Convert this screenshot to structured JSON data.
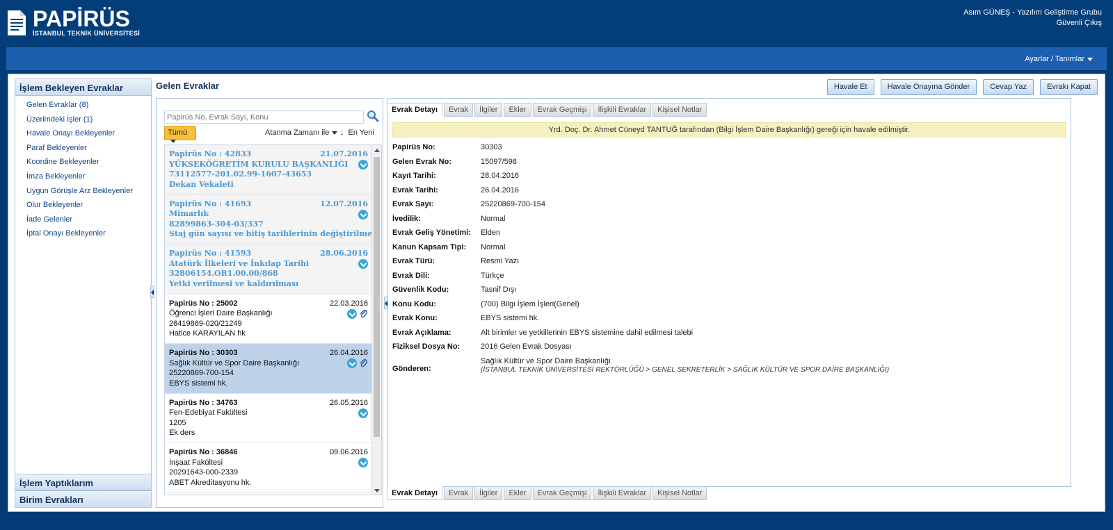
{
  "app": {
    "title": "PAPİRÜS",
    "subtitle": "İSTANBUL TEKNİK ÜNİVERSİTESİ"
  },
  "user": {
    "name": "Asım GÜNEŞ - Yazılım Geliştirme Grubu",
    "logout": "Güvenli Çıkış"
  },
  "topbar": {
    "settings": "Ayarlar / Tanımlar"
  },
  "leftnav": {
    "header": "İşlem Bekleyen Evraklar",
    "items": [
      "Gelen Evraklar (8)",
      "Üzerimdeki İşler (1)",
      "Havale Onayı Bekleyenler",
      "Paraf Bekleyenler",
      "Koordine Bekleyenler",
      "İmza Bekleyenler",
      "Uygun Görüşle Arz Bekleyenler",
      "Olur Bekleyenler",
      "İade Gelenler",
      "İptal Onayı Bekleyenler"
    ],
    "bottom": [
      "İşlem Yaptıklarım",
      "Birim Evrakları"
    ]
  },
  "page": {
    "title": "Gelen Evraklar"
  },
  "toolbar": {
    "buttons": [
      "Havale Et",
      "Havale Onayına Gönder",
      "Cevap Yaz",
      "Evrakı Kapat"
    ]
  },
  "list": {
    "search_placeholder": "Papirüs No, Evrak Sayı, Konu",
    "filter": "Tümü",
    "sort": "Atanma Zamanı ile",
    "sort_dir": "En Yeni",
    "items": [
      {
        "no": "Papirüs No : 42833",
        "date": "21.07.2016",
        "l1": "YÜKSEKÖĞRETİM KURULU BAŞKANLIĞI",
        "l2": "73112577-201.02.99-1607-43653",
        "l3": "Dekan Vekaleti"
      },
      {
        "no": "Papirüs No : 41693",
        "date": "12.07.2016",
        "l1": "Mimarlık",
        "l2": "82899863-304-03/337",
        "l3": "Staj gün sayısı ve bitiş tarihlerinin değiştirilmesi"
      },
      {
        "no": "Papirüs No : 41593",
        "date": "28.06.2016",
        "l1": "Atatürk İlkeleri ve İnkılap Tarihi",
        "l2": "32806154.OR1.00.00/868",
        "l3": "Yetki verilmesi ve kaldırılması"
      },
      {
        "no": "Papirüs No : 25002",
        "date": "22.03.2016",
        "l1": "Öğrenci İşleri Daire Başkanlığı",
        "l2": "26419869-020/21249",
        "l3": "Hatice KARAYILAN hk"
      },
      {
        "no": "Papirüs No : 30303",
        "date": "26.04.2016",
        "l1": "Sağlık Kültür ve Spor Daire Başkanlığı",
        "l2": "25220869-700-154",
        "l3": "EBYS sistemi hk."
      },
      {
        "no": "Papirüs No : 34763",
        "date": "26.05.2016",
        "l1": "Fen-Edebiyat Fakültesi",
        "l2": "1205",
        "l3": "Ek ders"
      },
      {
        "no": "Papirüs No : 36846",
        "date": "09.06.2016",
        "l1": "İnşaat Fakültesi",
        "l2": "20291643-000-2339",
        "l3": "ABET Akreditasyonu hk."
      }
    ]
  },
  "tabs": [
    "Evrak Detayı",
    "Evrak",
    "İlgiler",
    "Ekler",
    "Evrak Geçmişi",
    "İlişkili Evraklar",
    "Kişisel Notlar"
  ],
  "detail": {
    "notice": "Yrd. Doç. Dr. Ahmet Cüneyd TANTUĞ tarafından (Bilgi İşlem Daire Başkanlığı) gereği için havale edilmiştir.",
    "fields": [
      {
        "label": "Papirüs No:",
        "value": "30303"
      },
      {
        "label": "Gelen Evrak No:",
        "value": "15097/598"
      },
      {
        "label": "Kayıt Tarihi:",
        "value": "28.04.2016"
      },
      {
        "label": "Evrak Tarihi:",
        "value": "26.04.2016"
      },
      {
        "label": "Evrak Sayı:",
        "value": "25220869-700-154"
      },
      {
        "label": "İvedilik:",
        "value": "Normal"
      },
      {
        "label": "Evrak Geliş Yönetimi:",
        "value": "Elden"
      },
      {
        "label": "Kanun Kapsam Tipi:",
        "value": "Normal"
      },
      {
        "label": "Evrak Türü:",
        "value": "Resmi Yazı"
      },
      {
        "label": "Evrak Dili:",
        "value": "Türkçe"
      },
      {
        "label": "Güvenlik Kodu:",
        "value": "Tasnif Dışı"
      },
      {
        "label": "Konu Kodu:",
        "value": "(700) Bilgi İşlem İşleri(Genel)"
      },
      {
        "label": "Evrak Konu:",
        "value": "EBYS sistemi hk."
      },
      {
        "label": "Evrak Açıklama:",
        "value": "Alt birimler ve yetkillerinin EBYS sistemine dahil edilmesi talebi"
      },
      {
        "label": "Fiziksel Dosya No:",
        "value": "2016 Gelen Evrak Dosyası"
      }
    ],
    "sender": {
      "label": "Gönderen:",
      "value": "Sağlık Kültür ve Spor Daire Başkanlığı",
      "path": "(İSTANBUL TEKNİK ÜNİVERSİTESİ REKTÖRLÜĞÜ > GENEL SEKRETERLİK > SAĞLIK KÜLTÜR VE SPOR DAİRE BAŞKANLIĞI)"
    }
  }
}
